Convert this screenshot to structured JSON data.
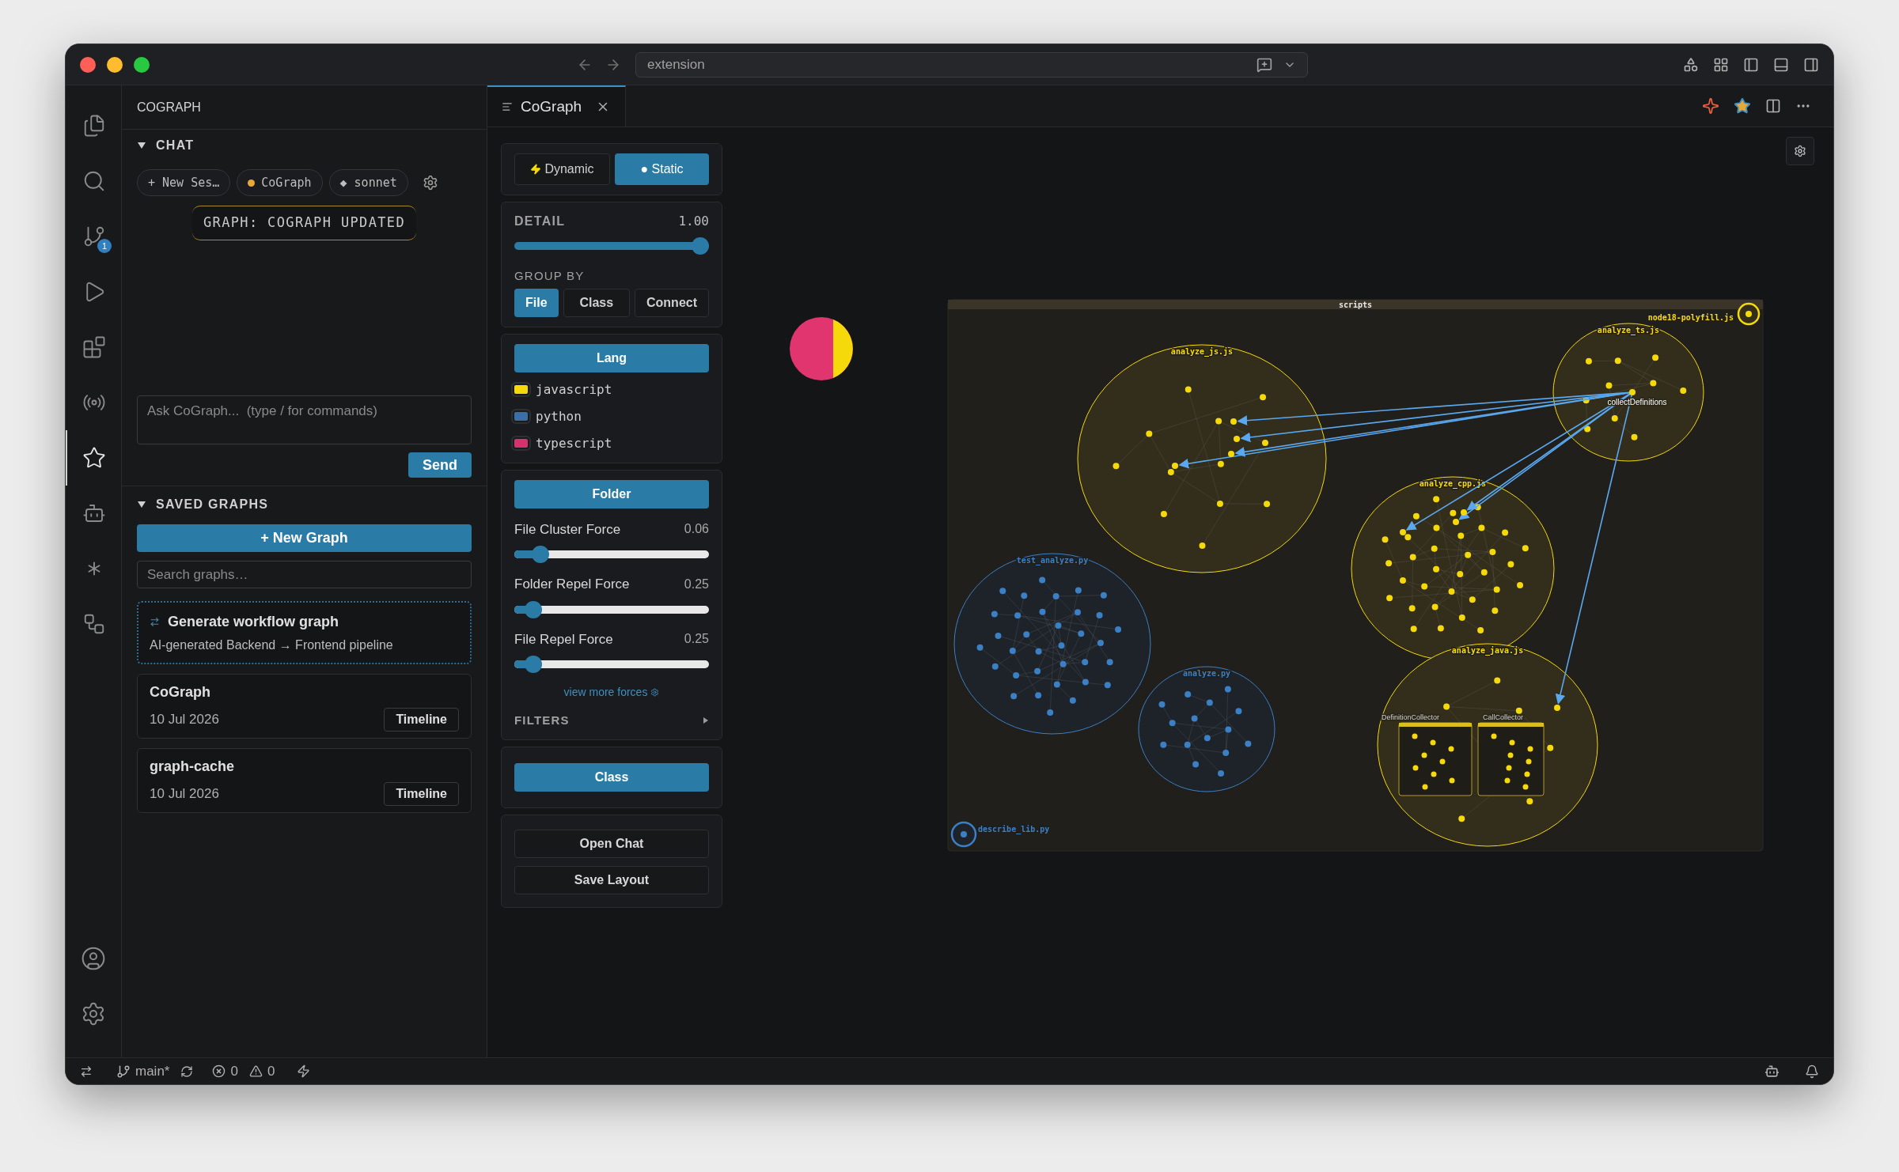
{
  "window": {
    "search": "extension"
  },
  "activity_bar": {
    "items": [
      {
        "kind": "files",
        "selected": false
      },
      {
        "kind": "search",
        "selected": false
      },
      {
        "kind": "source-control",
        "selected": false,
        "badge": "1"
      },
      {
        "kind": "run",
        "selected": false
      },
      {
        "kind": "extensions",
        "selected": false
      },
      {
        "kind": "remote",
        "selected": false
      },
      {
        "kind": "cograph",
        "selected": true
      },
      {
        "kind": "bot",
        "selected": false
      },
      {
        "kind": "asterisk",
        "selected": false
      },
      {
        "kind": "workflow",
        "selected": false
      }
    ],
    "bottom": [
      {
        "kind": "account"
      },
      {
        "kind": "settings"
      }
    ]
  },
  "sidebar": {
    "title": "COGRAPH",
    "chat": {
      "heading": "CHAT",
      "expanded": true,
      "chips": [
        {
          "label": "+ New Ses…"
        },
        {
          "label": "CoGraph",
          "color": "#e8a838"
        },
        {
          "label": "◆ sonnet"
        }
      ],
      "banner": "GRAPH: COGRAPH UPDATED",
      "placeholder": "Ask CoGraph...  (type / for commands)",
      "send": "Send"
    },
    "saved": {
      "heading": "SAVED GRAPHS",
      "expanded": true,
      "new_button": "+ New Graph",
      "search_placeholder": "Search graphs…",
      "workflow": {
        "title": "Generate workflow graph",
        "subtitle": "AI-generated Backend → Frontend pipeline"
      },
      "graphs": [
        {
          "name": "CoGraph",
          "date": "10 Jul 2026",
          "action": "Timeline"
        },
        {
          "name": "graph-cache",
          "date": "10 Jul 2026",
          "action": "Timeline"
        }
      ]
    }
  },
  "tab": {
    "label": "CoGraph",
    "selected": true
  },
  "controls": {
    "modes": [
      {
        "label": "Dynamic",
        "kind": "dynamic",
        "selected": false
      },
      {
        "label": "● Static",
        "kind": "static",
        "selected": true
      }
    ],
    "detail": {
      "label": "DETAIL",
      "reading": "1.00",
      "level": 1
    },
    "group_by": {
      "label": "GROUP BY",
      "options": [
        {
          "label": "File",
          "selected": true
        },
        {
          "label": "Class",
          "selected": false
        },
        {
          "label": "Connect",
          "selected": false
        }
      ]
    },
    "lang": {
      "button": "Lang",
      "items": [
        {
          "label": "javascript",
          "color": "#f5d90a"
        },
        {
          "label": "python",
          "color": "#3a6ea5"
        },
        {
          "label": "typescript",
          "color": "#d6336c"
        }
      ]
    },
    "folder": {
      "button": "Folder",
      "sliders": [
        {
          "label": "File Cluster Force",
          "reading": "0.06",
          "level": 0.1
        },
        {
          "label": "Folder Repel Force",
          "reading": "0.25",
          "level": 0.06
        },
        {
          "label": "File Repel Force",
          "reading": "0.25",
          "level": 0.06
        }
      ],
      "link": "view more forces"
    },
    "filters": {
      "heading": "FILTERS",
      "expanded": false
    },
    "class_button": "Class",
    "actions": [
      "Open Chat",
      "Save Layout"
    ]
  },
  "graph": {
    "frame_label": "scripts",
    "clusters": [
      {
        "label": "analyze_js.js",
        "color": "#f5d90a"
      },
      {
        "label": "analyze_ts.js",
        "color": "#f5d90a"
      },
      {
        "label": "analyze_cpp.js",
        "color": "#f5d90a"
      },
      {
        "label": "analyze_java.js",
        "color": "#f5d90a"
      },
      {
        "label": "test_analyze.py",
        "color": "#3b7fc4"
      },
      {
        "label": "analyze.py",
        "color": "#3b7fc4"
      },
      {
        "label": "describe_lib.py",
        "color": "#3b7fc4"
      },
      {
        "label": "node18-polyfill.js",
        "color": "#f5d90a"
      }
    ],
    "node_label": "collectDefinitions",
    "class_boxes": [
      "DefinitionCollector",
      "CallCollector"
    ]
  },
  "status_bar": {
    "branch": "main*",
    "errors": "0",
    "warnings": "0"
  }
}
